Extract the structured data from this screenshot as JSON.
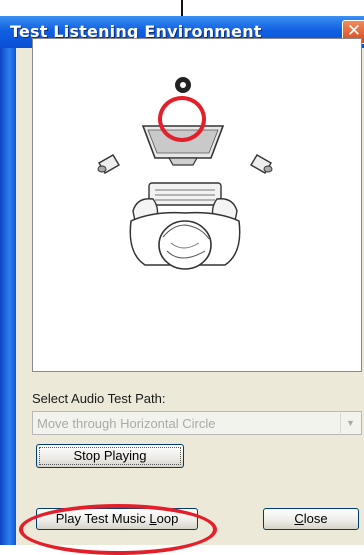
{
  "window": {
    "title": "Test Listening Environment",
    "close_glyph": "✕"
  },
  "diagram": {
    "icons": [
      "speaker-dot-icon",
      "monitor-icon",
      "left-speaker-icon",
      "right-speaker-icon",
      "keyboard-icon",
      "listener-icon"
    ]
  },
  "audio_path": {
    "label": "Select Audio Test Path:",
    "value": "Move through Horizontal Circle",
    "arrow_glyph": "▼"
  },
  "buttons": {
    "stop_label": "Stop Playing",
    "play_prefix": "Play Test Music ",
    "play_accel": "L",
    "play_suffix": "oop",
    "close_accel": "C",
    "close_suffix": "lose"
  },
  "colors": {
    "highlight": "#e3202a",
    "titlebar": "#0a4fd4"
  }
}
